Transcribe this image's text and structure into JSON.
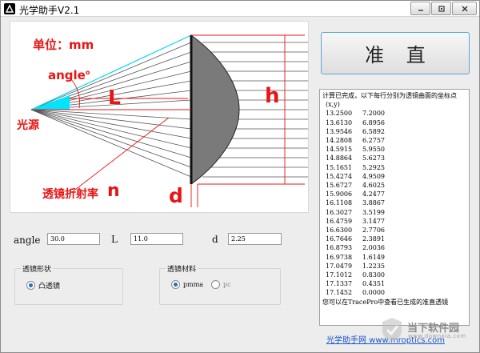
{
  "window": {
    "title": "光学助手V2.1"
  },
  "diagram": {
    "unit_label": "单位：mm",
    "angle_label": "angle",
    "angle_degree": "o",
    "length_label": "L",
    "height_label": "h",
    "source_label": "光源",
    "refractive_label": "透镜折射率",
    "refractive_symbol": "n",
    "thickness_label": "d"
  },
  "action": {
    "collimate_label": "准 直"
  },
  "output": {
    "header": "计算已完成，以下每行分别为透镜曲面的坐标点",
    "columns": "(x,y)",
    "rows": [
      [
        "13.2500",
        "7.2000"
      ],
      [
        "13.6130",
        "6.8956"
      ],
      [
        "13.9546",
        "6.5892"
      ],
      [
        "14.2808",
        "6.2757"
      ],
      [
        "14.5915",
        "5.9550"
      ],
      [
        "14.8864",
        "5.6273"
      ],
      [
        "15.1651",
        "5.2925"
      ],
      [
        "15.4274",
        "4.9509"
      ],
      [
        "15.6727",
        "4.6025"
      ],
      [
        "15.9006",
        "4.2477"
      ],
      [
        "16.1108",
        "3.8867"
      ],
      [
        "16.3027",
        "3.5199"
      ],
      [
        "16.4759",
        "3.1477"
      ],
      [
        "16.6300",
        "2.7706"
      ],
      [
        "16.7646",
        "2.3891"
      ],
      [
        "16.8793",
        "2.0036"
      ],
      [
        "16.9738",
        "1.6149"
      ],
      [
        "17.0479",
        "1.2235"
      ],
      [
        "17.1012",
        "0.8300"
      ],
      [
        "17.1337",
        "0.4351"
      ],
      [
        "17.1452",
        "0.0000"
      ]
    ],
    "footer": "您可以在TracePro中查看已生成的准直透镜"
  },
  "params": {
    "angle_label": "angle",
    "angle_value": "30.0",
    "L_label": "L",
    "L_value": "11.0",
    "d_label": "d",
    "d_value": "2.25"
  },
  "lens_shape": {
    "title": "透镜形状",
    "option_convex": "凸透镜"
  },
  "lens_material": {
    "title": "透镜材料",
    "option_pmma": "pmma",
    "option_pc": "pc"
  },
  "footer": {
    "link": "光学助手网 www.mroptics.com"
  },
  "watermark": {
    "text": "当下软件园",
    "sub": "www.downxia.com"
  },
  "colors": {
    "label_red": "#e81414",
    "ray_gray": "#555555",
    "lens_fill": "#7a7a7a",
    "angle_cyan": "#00e5ff",
    "accent_blue": "#5aa6d8"
  }
}
